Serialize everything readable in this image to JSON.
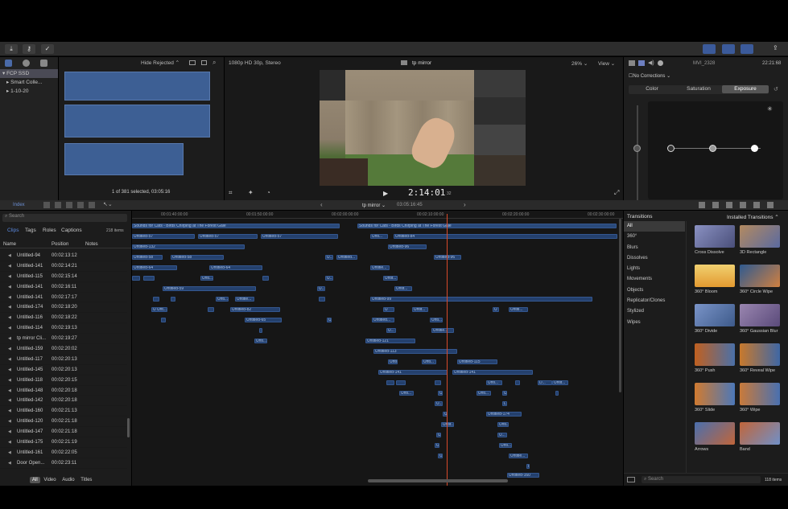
{
  "toolbar": {
    "import_icon": "download-icon",
    "keywords_icon": "key-icon",
    "check_icon": "checkmark-icon"
  },
  "libraries": {
    "items": [
      {
        "label": "FCP SSD"
      },
      {
        "label": "Smart Colle..."
      },
      {
        "label": "1-10-20"
      }
    ]
  },
  "browser": {
    "filter": "Hide Rejected",
    "selection_status": "1 of 381 selected, 03:05:16"
  },
  "viewer": {
    "format": "1080p HD 30p, Stereo",
    "title": "tp mirror",
    "zoom": "26%",
    "view_label": "View",
    "timecode": "2:14:01",
    "timecode_frames": "32"
  },
  "inspector": {
    "clip_name": "MVI_2328",
    "duration": "22:21:68",
    "corrections": "No Corrections",
    "tabs": [
      "Color",
      "Saturation",
      "Exposure"
    ],
    "active_tab": "Exposure"
  },
  "timeline_index": {
    "title": "Index",
    "tabs": [
      "Clips",
      "Tags",
      "Roles",
      "Captions"
    ],
    "item_count": "218 items",
    "search_placeholder": "Search",
    "columns": [
      "Name",
      "Position",
      "Notes"
    ],
    "rows": [
      {
        "name": "Untitled-94",
        "pos": "00:02:13:12"
      },
      {
        "name": "Untitled-141",
        "pos": "00:02:14:21"
      },
      {
        "name": "Untitled-115",
        "pos": "00:02:15:14"
      },
      {
        "name": "Untitled-141",
        "pos": "00:02:16:11"
      },
      {
        "name": "Untitled-141",
        "pos": "00:02:17:17"
      },
      {
        "name": "Untitled-174",
        "pos": "00:02:18:20"
      },
      {
        "name": "Untitled-116",
        "pos": "00:02:18:22"
      },
      {
        "name": "Untitled-114",
        "pos": "00:02:19:13"
      },
      {
        "name": "tp mirror Cli...",
        "pos": "00:02:19:27"
      },
      {
        "name": "Untitled-159",
        "pos": "00:02:20:02"
      },
      {
        "name": "Untitled-117",
        "pos": "00:02:20:13"
      },
      {
        "name": "Untitled-145",
        "pos": "00:02:20:13"
      },
      {
        "name": "Untitled-118",
        "pos": "00:02:20:15"
      },
      {
        "name": "Untitled-148",
        "pos": "00:02:20:18"
      },
      {
        "name": "Untitled-142",
        "pos": "00:02:20:18"
      },
      {
        "name": "Untitled-160",
        "pos": "00:02:21:13"
      },
      {
        "name": "Untitled-120",
        "pos": "00:02:21:18"
      },
      {
        "name": "Untitled-147",
        "pos": "00:02:21:18"
      },
      {
        "name": "Untitled-175",
        "pos": "00:02:21:19"
      },
      {
        "name": "Untitled-161",
        "pos": "00:02:22:05"
      },
      {
        "name": "Door Open...",
        "pos": "00:02:23:11"
      }
    ],
    "bottom_tabs": [
      "All",
      "Video",
      "Audio",
      "Titles"
    ]
  },
  "timeline": {
    "project": "tp mirror",
    "duration": "03:05:16:45",
    "ruler": [
      "00:01:40:00:00",
      "00:01:50:00:00",
      "00:02:00:00:00",
      "00:02:10:00:00",
      "00:02:20:00:00",
      "00:02:30:00:00"
    ]
  },
  "transitions": {
    "title": "Transitions",
    "installed": "Installed Transitions",
    "count": "118 items",
    "search_placeholder": "Search",
    "categories": [
      "All",
      "360°",
      "Blurs",
      "Dissolves",
      "Lights",
      "Movements",
      "Objects",
      "Replicator/Clones",
      "Stylized",
      "Wipes"
    ],
    "items": [
      "Cross Dissolve",
      "3D Rectangle",
      "360° Bloom",
      "360° Circle Wipe",
      "360° Divide",
      "360° Gaussian Blur",
      "360° Push",
      "360° Reveal Wipe",
      "360° Slide",
      "360° Wipe",
      "Arrows",
      "Band"
    ]
  }
}
